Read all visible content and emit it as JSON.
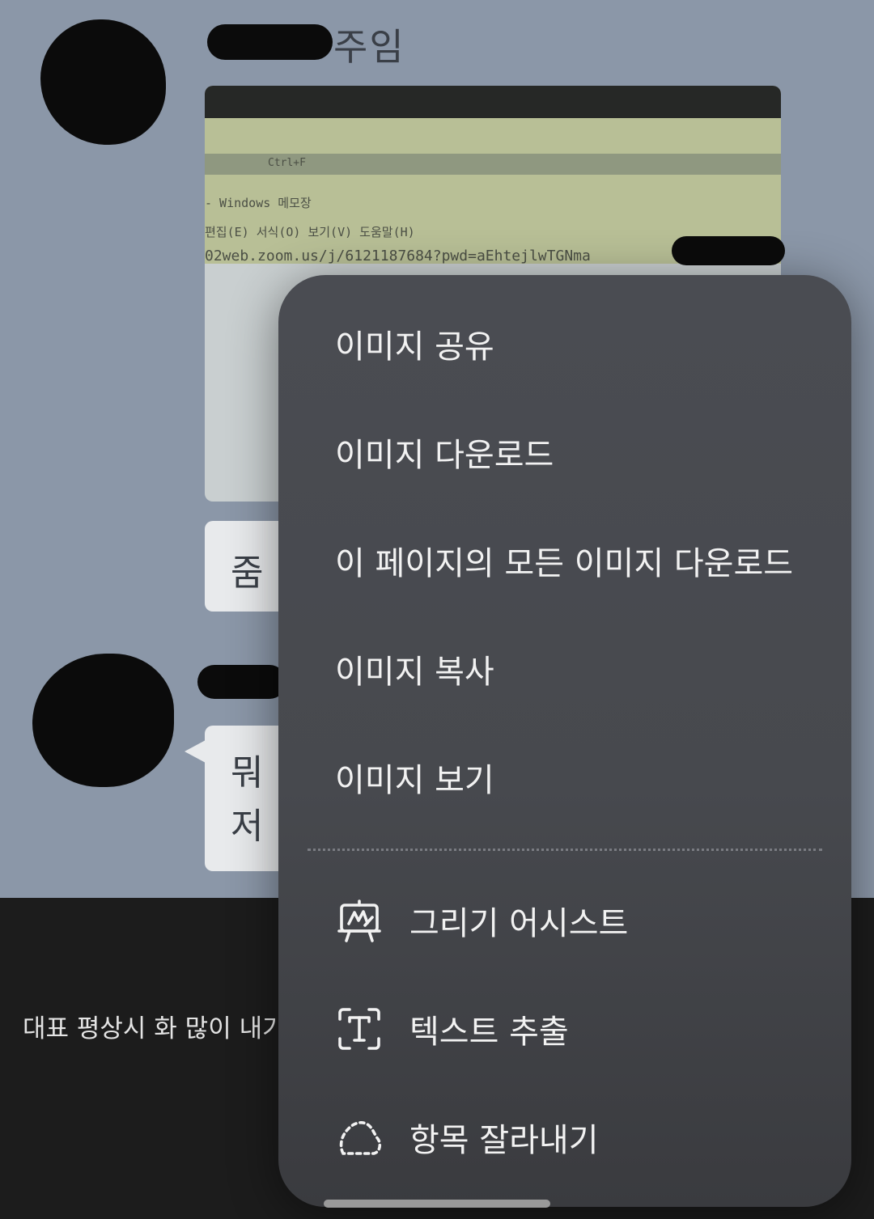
{
  "chat": {
    "sender_name_suffix": "주임",
    "photo_lines": {
      "tab_label": "Ctrl+F",
      "window_title": "- Windows 메모장",
      "menu_bar": "편집(E)   서식(O)   보기(V)   도움말(H)",
      "url_text": "02web.zoom.us/j/6121187684?pwd=aEhtejlwTGNma"
    },
    "bubble_1_text": "줌",
    "bubble_2_line_1": "뭐",
    "bubble_2_line_2": "저",
    "bottom_caption": "대표 평상시 화 많이 내가"
  },
  "menu": {
    "share_image": "이미지 공유",
    "download_image": "이미지 다운로드",
    "download_all_images": "이 페이지의 모든 이미지 다운로드",
    "copy_image": "이미지 복사",
    "view_image": "이미지 보기",
    "drawing_assist": "그리기 어시스트",
    "extract_text": "텍스트 추출",
    "crop_item": "항목 잘라내기"
  },
  "icons": {
    "drawing_assist": "easel-pen-icon",
    "extract_text": "text-frame-icon",
    "crop_item": "dashed-lasso-icon"
  },
  "colors": {
    "menu_background": "#48494e",
    "menu_text": "#f2f2f2",
    "chat_background": "#8b97a8",
    "bottom_background": "#1c1c1c"
  }
}
